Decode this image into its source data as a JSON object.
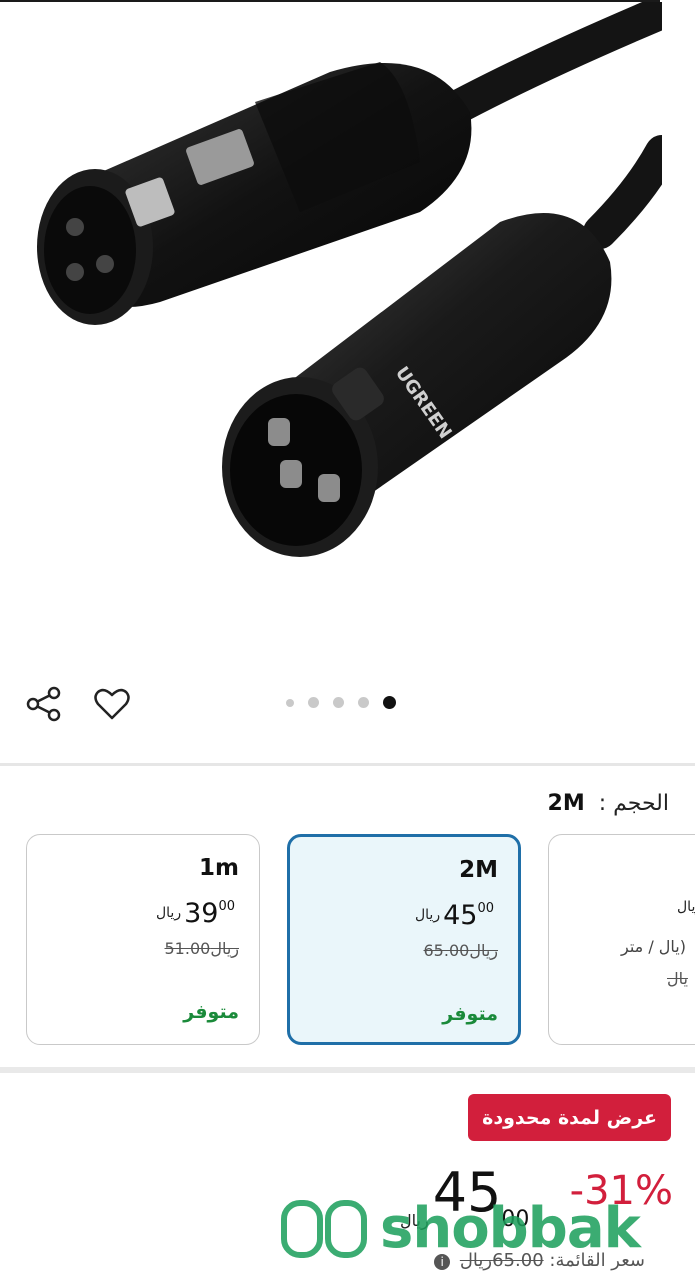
{
  "product": {
    "image_alt": "XLR microphone cable",
    "brand_on_connector": "UGREEN"
  },
  "gallery": {
    "count": 5,
    "active_index": 4
  },
  "size_selector": {
    "label": "الحجم :",
    "value": "2M"
  },
  "variants": [
    {
      "name": "1m",
      "price_int": "39",
      "price_dec": "00",
      "currency": "ريال",
      "old_price": "51.00ريال",
      "stock": "متوفر",
      "selected": false
    },
    {
      "name": "2M",
      "price_int": "45",
      "price_dec": "00",
      "currency": "ريال",
      "old_price": "65.00ريال",
      "stock": "متوفر",
      "selected": true
    },
    {
      "price_suffix": "ريال",
      "unit_text": "يال / متر)",
      "old_price": "يال",
      "partial": true
    }
  ],
  "offer": {
    "badge": "عرض لمدة محدودة",
    "discount": "-31%",
    "price_int": "45",
    "price_dec": "00",
    "currency": "ريال",
    "list_price_label": "سعر القائمة:",
    "list_price": "65.00ريال"
  },
  "watermark": {
    "text": "shobbak"
  },
  "colors": {
    "accent_red": "#d21f3c",
    "stock_green": "#1a8a3a",
    "selected_border": "#1f6fa8",
    "watermark_green": "#1a9e5a"
  }
}
